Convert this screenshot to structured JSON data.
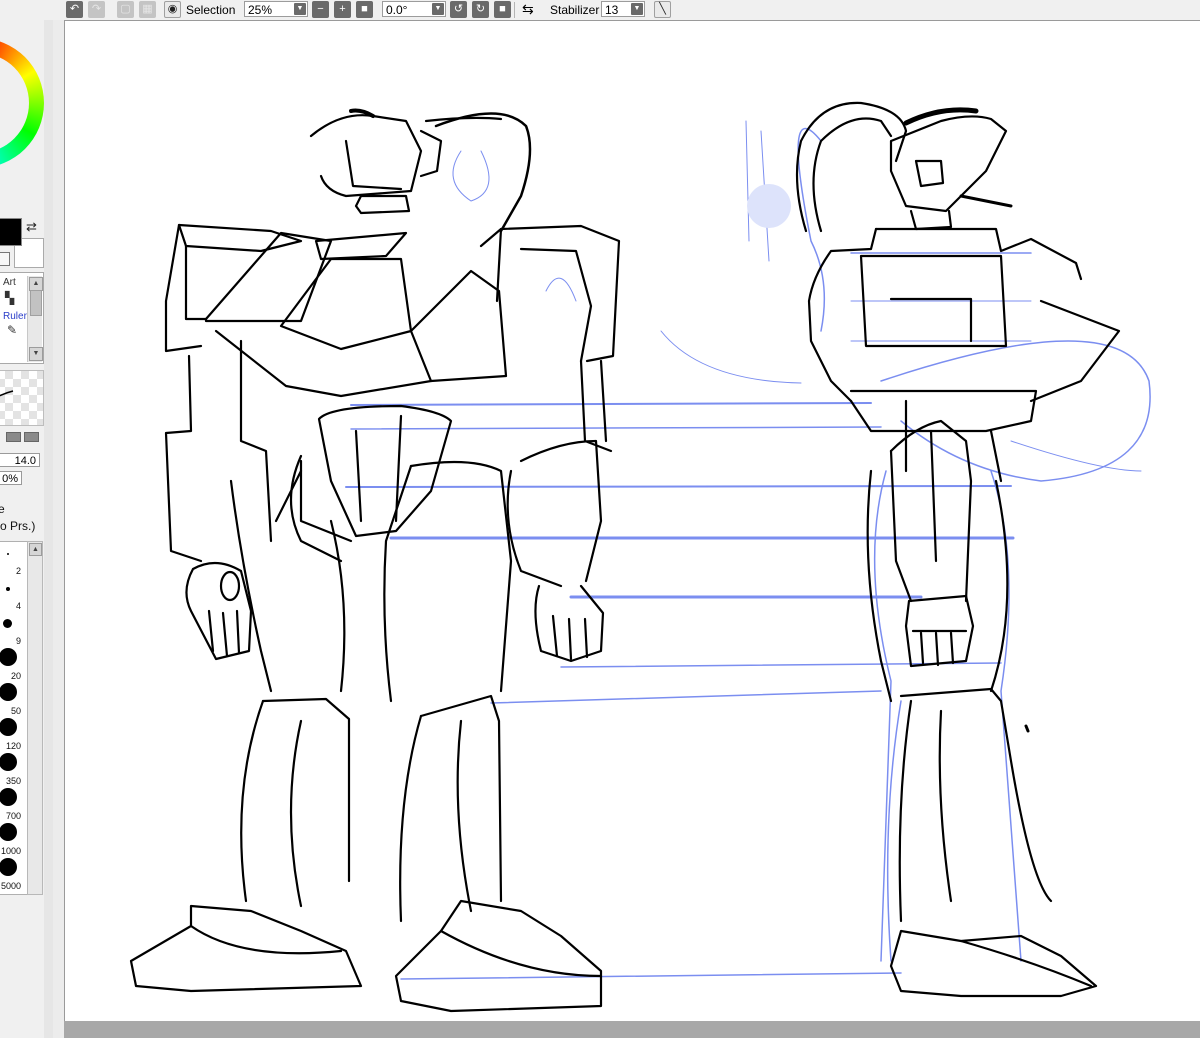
{
  "toolbar": {
    "view_label": "Selection",
    "zoom_value": "25%",
    "rotation_value": "0.0°",
    "stabilizer_label": "Stabilizer",
    "stabilizer_value": "13"
  },
  "left_panel": {
    "tool_list": [
      "Art",
      "Rulers"
    ],
    "brush_size": "14.0",
    "density": "0%",
    "option_1": "e",
    "pressure_option": "Jo Prs.)",
    "brush_sizes": [
      "2",
      "4",
      "9",
      "20",
      "50",
      "120",
      "350",
      "700",
      "1000",
      "5000"
    ]
  },
  "colors": {
    "panel_bg": "#f0f0f0",
    "canvas_bg": "#ffffff",
    "ink": "#000000",
    "guide_blue": "#7b8ef0",
    "scroll_gray": "#a8a8a8"
  }
}
